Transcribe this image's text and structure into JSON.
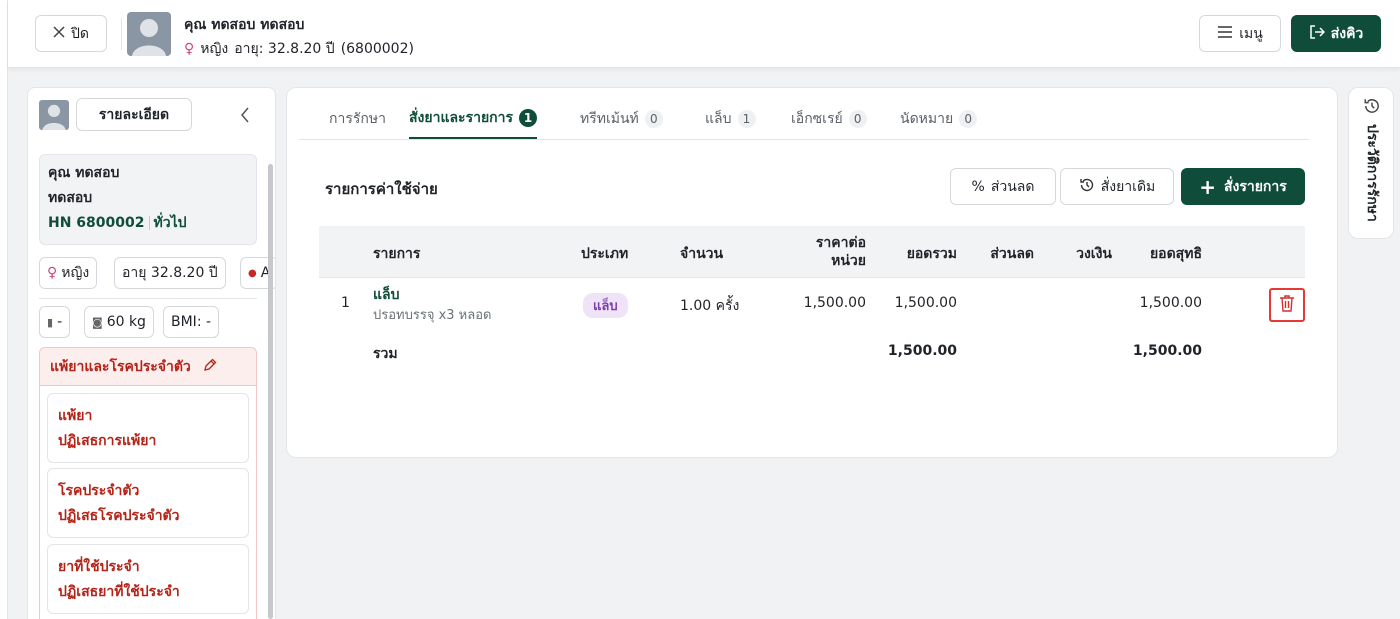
{
  "header": {
    "close_label": "ปิด",
    "patient_name": "คุณ ทดสอบ ทดสอบ",
    "gender": "หญิง",
    "age_label": "อายุ: 32.8.20 ปี",
    "hn_paren": "(6800002)",
    "menu_label": "เมนู",
    "send_label": "ส่งคิว"
  },
  "sidebar": {
    "detail_label": "รายละเอียด",
    "name_line1": "คุณ ทดสอบ",
    "name_line2": "ทดสอบ",
    "hn": "HN 6800002",
    "patient_type": "ทั่วไป",
    "gender": "หญิง",
    "age": "อายุ 32.8.20 ปี",
    "blood": "A",
    "height": "-",
    "weight": "60 kg",
    "bmi": "BMI: -",
    "allergy_header": "แพ้ยาและโรคประจำตัว",
    "cards": [
      {
        "title": "แพ้ยา",
        "value": "ปฏิเสธการแพ้ยา"
      },
      {
        "title": "โรคประจำตัว",
        "value": "ปฏิเสธโรคประจำตัว"
      },
      {
        "title": "ยาที่ใช้ประจำ",
        "value": "ปฏิเสธยาที่ใช้ประจำ"
      }
    ]
  },
  "tabs": [
    {
      "label": "การรักษา",
      "count": ""
    },
    {
      "label": "สั่งยาและรายการ",
      "count": "1"
    },
    {
      "label": "ทรีทเม้นท์",
      "count": "0"
    },
    {
      "label": "แล็บ",
      "count": "1"
    },
    {
      "label": "เอ็กซเรย์",
      "count": "0"
    },
    {
      "label": "นัดหมาย",
      "count": "0"
    }
  ],
  "main": {
    "section_title": "รายการค่าใช้จ่าย",
    "discount_label": "ส่วนลด",
    "old_rx_label": "สั่งยาเดิม",
    "order_label": "สั่งรายการ",
    "columns": {
      "item": "รายการ",
      "type": "ประเภท",
      "qty": "จำนวน",
      "unit_price_1": "ราคาต่อ",
      "unit_price_2": "หน่วย",
      "total": "ยอดรวม",
      "discount": "ส่วนลด",
      "credit": "วงเงิน",
      "net": "ยอดสุทธิ"
    },
    "rows": [
      {
        "no": "1",
        "name": "แล็บ",
        "desc": "ปรอทบรรจุ x3 หลอด",
        "type": "แล็บ",
        "qty": "1.00 ครั้ง",
        "unit_price": "1,500.00",
        "total": "1,500.00",
        "discount": "",
        "credit": "",
        "net": "1,500.00"
      }
    ],
    "sum_label": "รวม",
    "sum_total": "1,500.00",
    "sum_net": "1,500.00"
  },
  "history": {
    "label": "ประวัติการรักษา"
  },
  "colors": {
    "primary": "#0f4d3a",
    "danger": "#d32f2f",
    "lab_badge": "#7b3fa8"
  }
}
